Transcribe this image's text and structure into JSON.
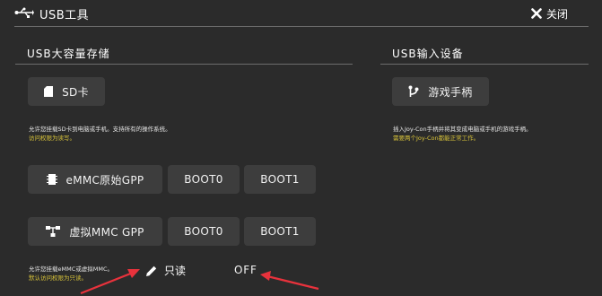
{
  "header": {
    "title": "USB工具",
    "close_label": "关闭",
    "usb_icon": "usb-icon",
    "close_icon": "close-x-icon"
  },
  "mass_storage": {
    "title": "USB大容量存储",
    "sd_button": "SD卡",
    "sd_note_line1": "允许您挂载SD卡到电脑或手机。支持所有的操作系统。",
    "sd_note_line2": "访问权限为读写。",
    "emmc_button": "eMMC原始GPP",
    "emmc_boot0": "BOOT0",
    "emmc_boot1": "BOOT1",
    "emu_button": "虚拟MMC GPP",
    "emu_boot0": "BOOT0",
    "emu_boot1": "BOOT1",
    "emmc_note_line1": "允许您挂载eMMC或虚拟MMC。",
    "emmc_note_line2": "默认访问权限为只读。",
    "readonly_label": "只读",
    "readonly_value": "OFF"
  },
  "input_device": {
    "title": "USB输入设备",
    "gamepad_button": "游戏手柄",
    "note_line1": "插入Joy-Con手柄并将其变成电脑或手机的游戏手柄。",
    "note_line2": "需要两个Joy-Con都能正常工作。"
  },
  "colors": {
    "background": "#2b2b2b",
    "button": "#3d3d3d",
    "warning_text": "#d9c43a",
    "annotation_arrow": "#e8323c"
  }
}
